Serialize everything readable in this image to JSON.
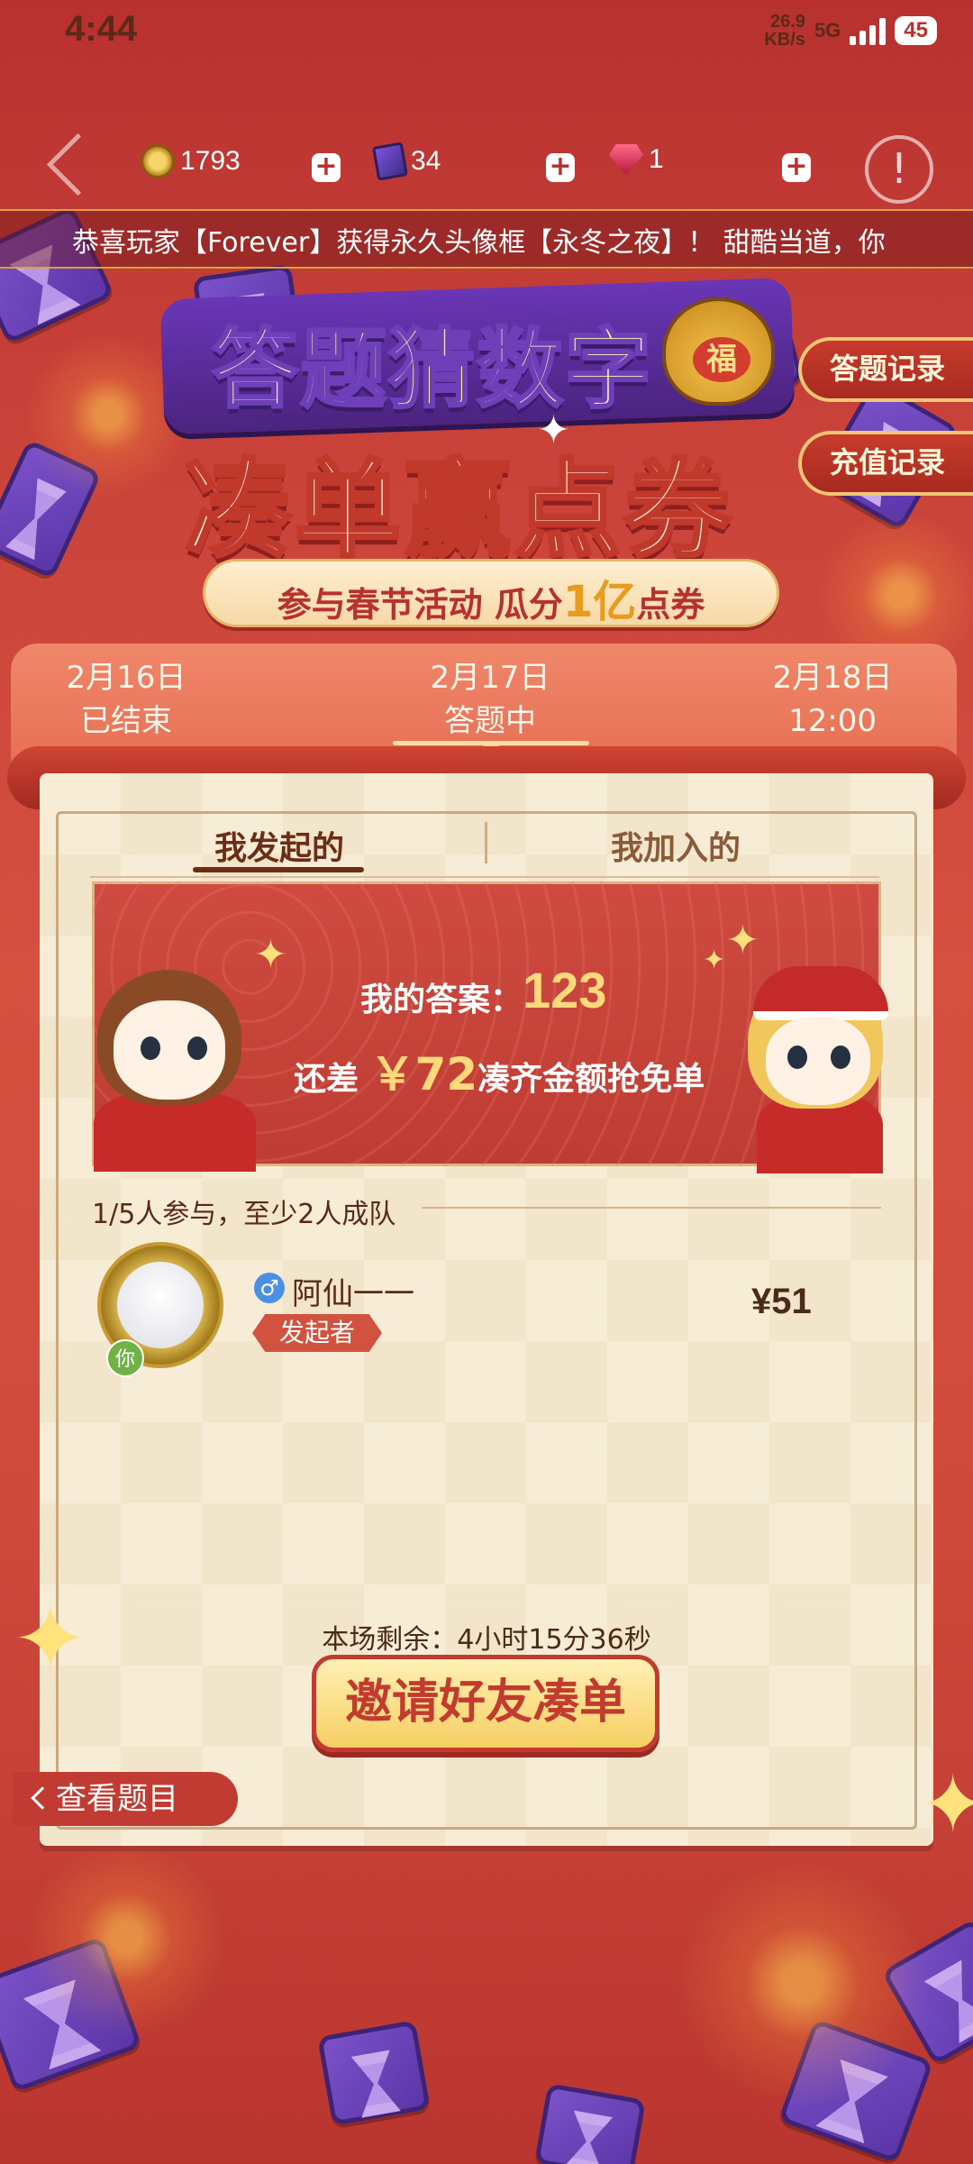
{
  "status_bar": {
    "time": "4:44",
    "net_speed_value": "26.9",
    "net_speed_unit": "KB/s",
    "network": "5G",
    "battery": "45"
  },
  "resources": {
    "coins": "1793",
    "gems": "34",
    "rubies": "1"
  },
  "marquee": "恭喜玩家【Forever】获得永久头像框【永冬之夜】！ 甜酷当道，你",
  "title": {
    "line1": "答题猜数字",
    "line2": "凑单赢点券",
    "bag_char": "福",
    "subtitle_prefix": "参与春节活动 瓜分",
    "subtitle_highlight": "1亿",
    "subtitle_suffix": "点券"
  },
  "side_buttons": {
    "answer_record": "答题记录",
    "recharge_record": "充值记录"
  },
  "date_tabs": [
    {
      "date": "2月16日",
      "status": "已结束"
    },
    {
      "date": "2月17日",
      "status": "答题中"
    },
    {
      "date": "2月18日",
      "status": "12:00"
    }
  ],
  "sub_tabs": {
    "initiated": "我发起的",
    "joined": "我加入的"
  },
  "banner": {
    "answer_label": "我的答案：",
    "answer_value": "123",
    "remain_prefix": "还差",
    "remain_amount": "￥72",
    "remain_suffix": "凑齐金额抢免单"
  },
  "team": {
    "info": "1/5人参与，至少2人成队"
  },
  "member": {
    "you_label": "你",
    "gender_symbol": "♂",
    "name": "阿仙一一",
    "role": "发起者",
    "amount": "¥51"
  },
  "countdown": "本场剩余：4小时15分36秒",
  "invite_button": "邀请好友凑单",
  "view_questions": "查看题目",
  "colors": {
    "background": "#c9423a",
    "accent_gold": "#ffd97a",
    "paper": "#f7ecd6",
    "brand_red": "#c23b2e"
  }
}
